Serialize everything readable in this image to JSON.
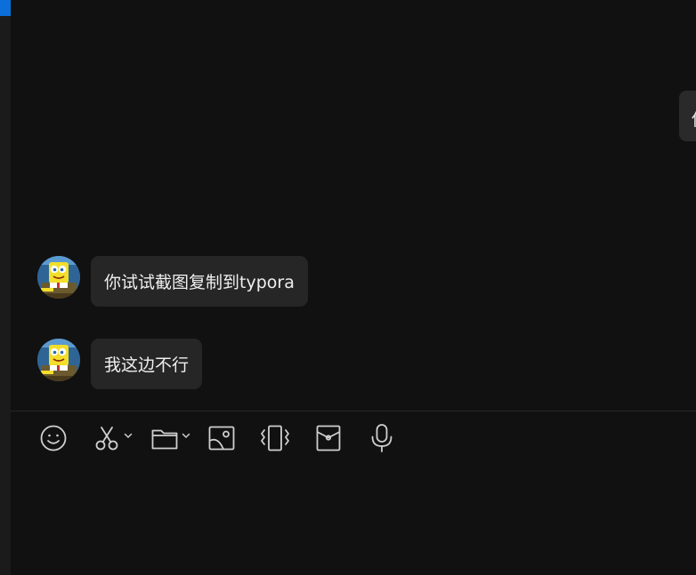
{
  "messages": [
    {
      "text": "你试试截图复制到typora",
      "avatar": "spongebob-avatar"
    },
    {
      "text": "我这边不行",
      "avatar": "spongebob-avatar"
    }
  ],
  "partial_message": {
    "text": "你"
  },
  "toolbar": {
    "icons": [
      "emoji-icon",
      "scissors-icon",
      "folder-icon",
      "image-icon",
      "shake-icon",
      "red-packet-icon",
      "microphone-icon"
    ]
  },
  "colors": {
    "background": "#111111",
    "bubble": "#262626",
    "accent": "#0a6fd8",
    "icon": "#cfcfcf"
  }
}
